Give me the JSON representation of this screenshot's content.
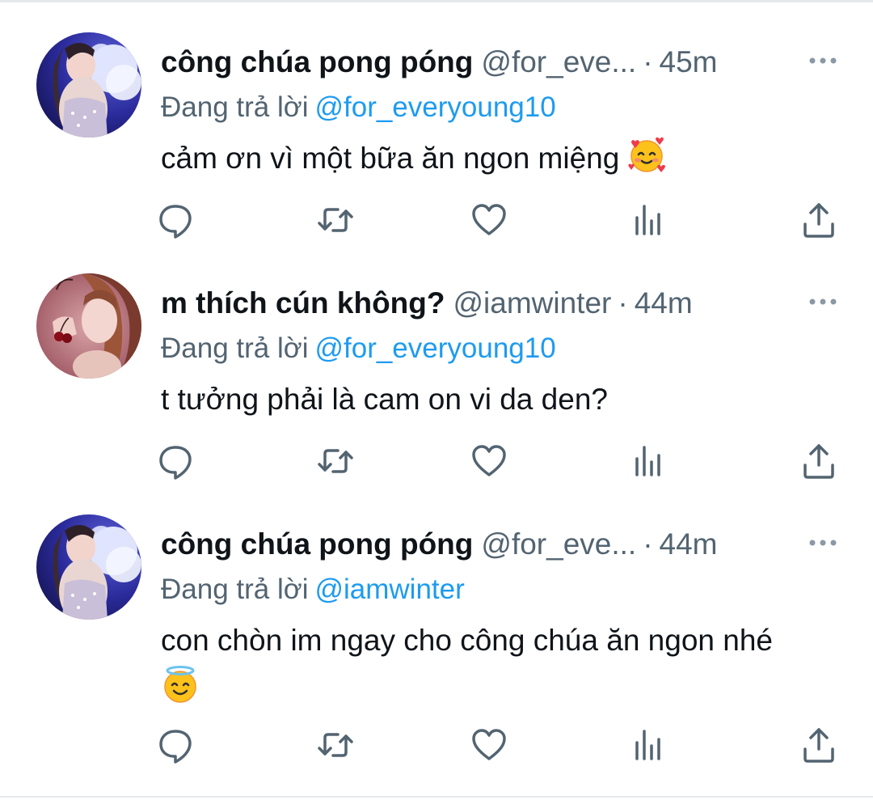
{
  "tweets": [
    {
      "display_name": "công chúa pong póng",
      "handle": "@for_eve...",
      "separator": "·",
      "time": "45m",
      "reply_prefix": "Đang trả lời",
      "reply_to": "@for_everyoung10",
      "text": "cảm ơn vì một bữa ăn ngon miệng",
      "emoji": "smiling-face-with-hearts"
    },
    {
      "display_name": "m thích cún không?",
      "handle": "@iamwinter",
      "separator": "·",
      "time": "44m",
      "reply_prefix": "Đang trả lời",
      "reply_to": "@for_everyoung10",
      "text": "t tưởng phải là cam on vi da den?",
      "emoji": ""
    },
    {
      "display_name": "công chúa pong póng",
      "handle": "@for_eve...",
      "separator": "·",
      "time": "44m",
      "reply_prefix": "Đang trả lời",
      "reply_to": "@iamwinter",
      "text": "con chòn im ngay cho công chúa ăn ngon nhé",
      "emoji": "smiling-face-with-halo"
    }
  ],
  "icons": {
    "more": "more-icon",
    "reply": "reply-icon",
    "retweet": "retweet-icon",
    "like": "like-icon",
    "views": "views-icon",
    "share": "share-icon"
  },
  "colors": {
    "text": "#0f1419",
    "secondary": "#536471",
    "link": "#1d9bf0",
    "divider": "#e6e9ec"
  }
}
